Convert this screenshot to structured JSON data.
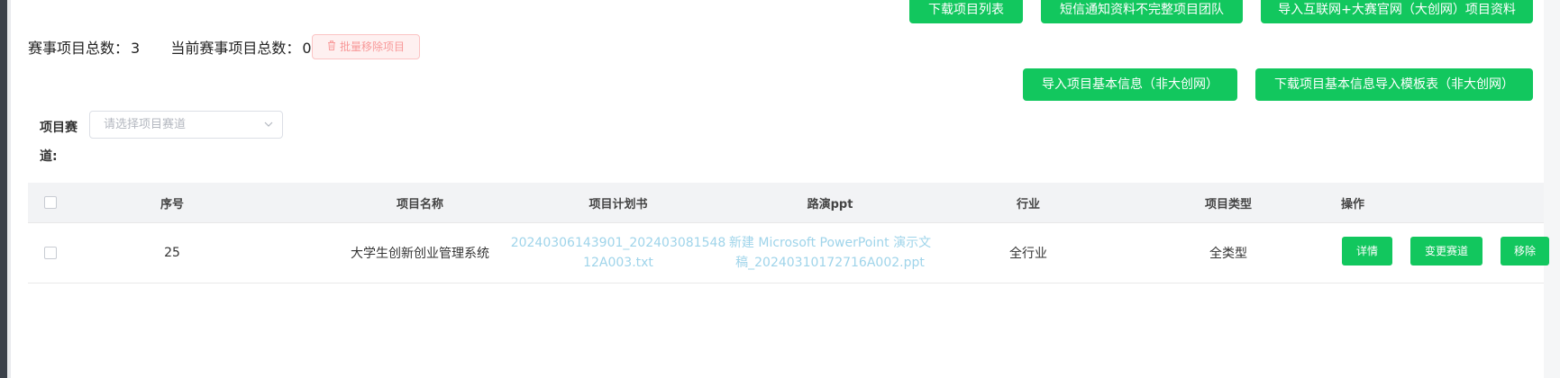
{
  "toolbar_top": {
    "download_list": "下载项目列表",
    "sms_notify": "短信通知资料不完整项目团队",
    "import_internet_plus": "导入互联网+大赛官网（大创网）项目资料"
  },
  "toolbar_second": {
    "import_basic": "导入项目基本信息（非大创网）",
    "download_template": "下载项目基本信息导入模板表（非大创网）"
  },
  "stats": {
    "total_label": "赛事项目总数：",
    "total_value": "3",
    "current_label": "当前赛事项目总数：",
    "current_value": "0"
  },
  "bulk_remove": {
    "label": "批量移除项目"
  },
  "filter": {
    "label": "项目赛道:",
    "placeholder": "请选择项目赛道"
  },
  "table": {
    "headers": {
      "index": "序号",
      "name": "项目名称",
      "plan": "项目计划书",
      "ppt": "路演ppt",
      "industry": "行业",
      "type": "项目类型",
      "actions": "操作"
    },
    "rows": [
      {
        "index": "25",
        "name": "大学生创新创业管理系统",
        "plan_line1": "20240306143901_202403081548",
        "plan_line2": "12A003.txt",
        "ppt_line1": "新建 Microsoft PowerPoint 演示文",
        "ppt_line2": "稿_20240310172716A002.ppt",
        "industry": "全行业",
        "type": "全类型",
        "actions": {
          "detail": "详情",
          "change_track": "变更赛道",
          "remove": "移除"
        }
      }
    ]
  },
  "colors": {
    "primary_green": "#12c75e",
    "link_blue": "#9fd4ea",
    "danger_border": "#fbc4c4",
    "danger_text": "#f89898"
  }
}
